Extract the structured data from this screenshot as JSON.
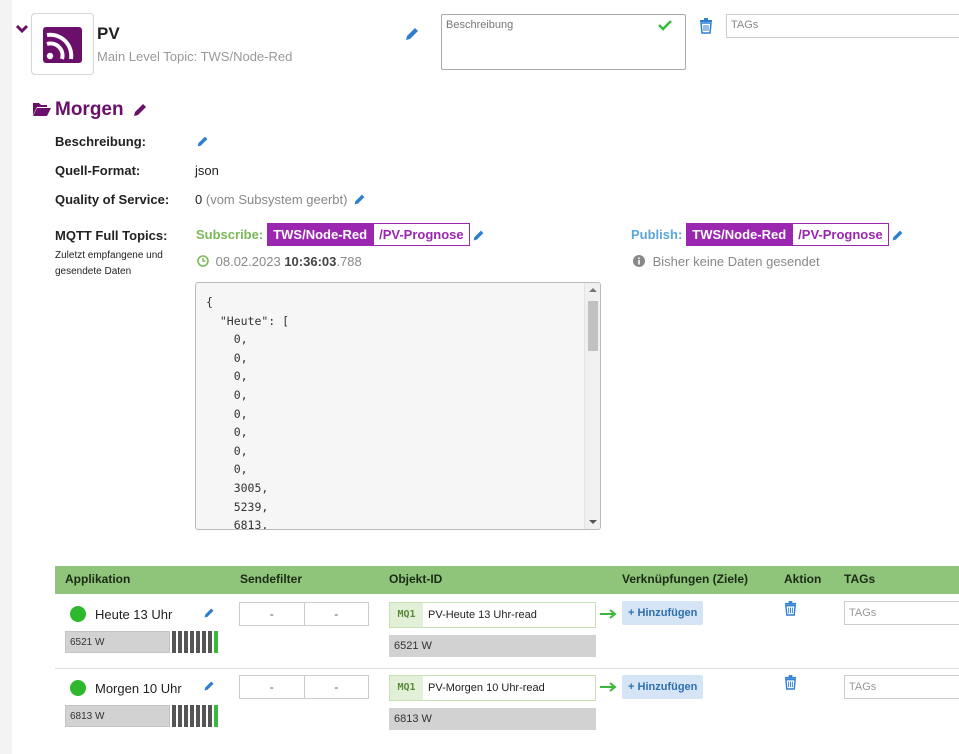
{
  "topic": {
    "name": "PV",
    "subtitle": "Main Level Topic: TWS/Node-Red",
    "description_placeholder": "Beschreibung",
    "tags_placeholder": "TAGs"
  },
  "section": {
    "title": "Morgen",
    "fields": {
      "description_label": "Beschreibung:",
      "source_format_label": "Quell-Format:",
      "source_format_value": "json",
      "qos_label": "Quality of Service:",
      "qos_value": "0",
      "qos_note": "(vom Subsystem geerbt)",
      "mqtt_label": "MQTT Full Topics:",
      "mqtt_note": "Zuletzt empfangene und gesendete Daten"
    },
    "subscribe": {
      "label": "Subscribe:",
      "prefix": "TWS/",
      "prefix_bold": "Node-Red",
      "suffix": "/PV-Prognose",
      "timestamp_date": "08.02.2023",
      "timestamp_time": "10:36:03",
      "timestamp_ms": ".788"
    },
    "publish": {
      "label": "Publish:",
      "prefix": "TWS/",
      "prefix_bold": "Node-Red",
      "suffix": "/PV-Prognose",
      "status": "Bisher keine Daten gesendet"
    },
    "json_payload": "{\n  \"Heute\": [\n    0,\n    0,\n    0,\n    0,\n    0,\n    0,\n    0,\n    0,\n    3005,\n    5239,\n    6813,"
  },
  "table": {
    "headers": {
      "app": "Applikation",
      "filter": "Sendefilter",
      "object": "Objekt-ID",
      "links": "Verknüpfungen (Ziele)",
      "action": "Aktion",
      "tags": "TAGs"
    },
    "rows": [
      {
        "name": "Heute 13 Uhr",
        "value": "6521 W",
        "filter_min": "-",
        "filter_max": "-",
        "object_tag": "MQ1",
        "object_id": "PV-Heute 13 Uhr-read",
        "object_value": "6521 W",
        "add_label": "Hinzufügen",
        "tags_placeholder": "TAGs"
      },
      {
        "name": "Morgen 10 Uhr",
        "value": "6813 W",
        "filter_min": "-",
        "filter_max": "-",
        "object_tag": "MQ1",
        "object_id": "PV-Morgen 10 Uhr-read",
        "object_value": "6813 W",
        "add_label": "Hinzufügen",
        "tags_placeholder": "TAGs"
      }
    ]
  },
  "colors": {
    "accent_purple": "#9b27b0",
    "title_purple": "#6a0f6a",
    "table_header_green": "#8fc57a",
    "status_green": "#2eb82e",
    "link_blue": "#2f7fd0"
  },
  "icons": [
    "chevron-down-icon",
    "rss-icon",
    "pencil-icon",
    "check-icon",
    "trash-icon",
    "folder-open-icon",
    "clock-icon",
    "info-icon",
    "arrow-right-icon",
    "plus-icon"
  ]
}
